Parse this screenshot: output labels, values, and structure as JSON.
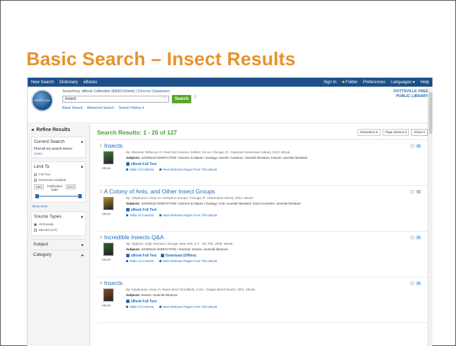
{
  "slide_title": "Basic Search – Insect Results",
  "topnav": {
    "left": [
      "New Search",
      "Dictionary",
      "eBooks"
    ],
    "right": [
      "Sign In",
      "Folder",
      "Preferences",
      "Languages ▾",
      "Help"
    ]
  },
  "header": {
    "logo_text": "EBSCO host",
    "searching_label": "Searching:",
    "database": "eBook Collection (EBSCOhost)",
    "choose_databases": "Choose Databases",
    "search_value": "insect",
    "search_button": "Search",
    "help_mark": "?",
    "links": [
      "Basic Search",
      "Advanced Search",
      "Search History ▾"
    ],
    "library_line1": "POTTSVILLE FREE",
    "library_line2": "PUBLIC LIBRARY"
  },
  "sidebar": {
    "refine_label": "Refine Results",
    "current_search_title": "Current Search",
    "find_all_label": "Find all my search terms:",
    "current_term": "insect",
    "limit_to_title": "Limit To",
    "limit_options": [
      "Full Text",
      "Download Available"
    ],
    "date_from": "1961",
    "date_label": "Publication Date",
    "date_to": "2013",
    "show_more": "Show More",
    "source_types_title": "Source Types",
    "source_options": [
      "All Results",
      "eBooks (127)"
    ],
    "subject_label": "Subject",
    "category_label": "Category"
  },
  "results": {
    "heading": "Search Results: 1 - 20 of 127",
    "tools": [
      "Relevance ▾",
      "Page Options ▾",
      "Share ▾"
    ],
    "items": [
      {
        "num": "1.",
        "title": "Insects",
        "meta": "By: Rissman, Rebecca. In: Real Size Science. Edition: 1st ed. Chicago, Ill : Capstone Heinemann Library. 2013. eBook.",
        "subjects_label": "Subjects:",
        "subjects": "JUVENILE NONFICTION / Science & Nature / Zoology; Insects--Anatomy--Juvenile literature; Insects--Juvenile literature",
        "type": "eBook",
        "link1": "eBook Full Text",
        "link2": "",
        "toc": "Table of Contents",
        "relevant": "Most Relevant Pages From This eBook",
        "cover_color": "#3f7a3a"
      },
      {
        "num": "2.",
        "title": "A Colony of Ants, and Other Insect Groups",
        "meta": "By: Claybourne, Anna. In: Animals in Groups. Chicago, Ill : Heinemann Library. 2013. eBook.",
        "subjects_label": "Subjects:",
        "subjects": "JUVENILE NONFICTION / Science & Nature / Zoology; Ants--Juvenile literature; Insect societies--Juvenile literature",
        "type": "eBook",
        "link1": "eBook Full Text",
        "link2": "",
        "toc": "Table of Contents",
        "relevant": "Most Relevant Pages From This eBook",
        "cover_color": "#b08a2c"
      },
      {
        "num": "3.",
        "title": "Incredible Insects Q&A",
        "meta": "By: Tagholm, Sally. McGavin, George. New York, N.Y. : DK Pub. 2008. eBook.",
        "subjects_label": "Subjects:",
        "subjects": "JUVENILE NONFICTION / General; Insects--Juvenile literature",
        "type": "eBook",
        "link1": "eBook Full Text",
        "link2": "Download (Offline)",
        "toc": "Table of Contents",
        "relevant": "Most Relevant Pages From This eBook",
        "cover_color": "#2f5f2a"
      },
      {
        "num": "4.",
        "title": "Insects",
        "meta": "By: Claybourne, Anna. In: Read About. Brookfield, Conn : Copper Beech Books. 2001. eBook.",
        "subjects_label": "Subjects:",
        "subjects": "Insects--Juvenile literature",
        "type": "eBook",
        "link1": "eBook Full Text",
        "link2": "",
        "toc": "Table of Contents",
        "relevant": "Most Relevant Pages From This eBook",
        "cover_color": "#8a4a2a"
      }
    ]
  }
}
